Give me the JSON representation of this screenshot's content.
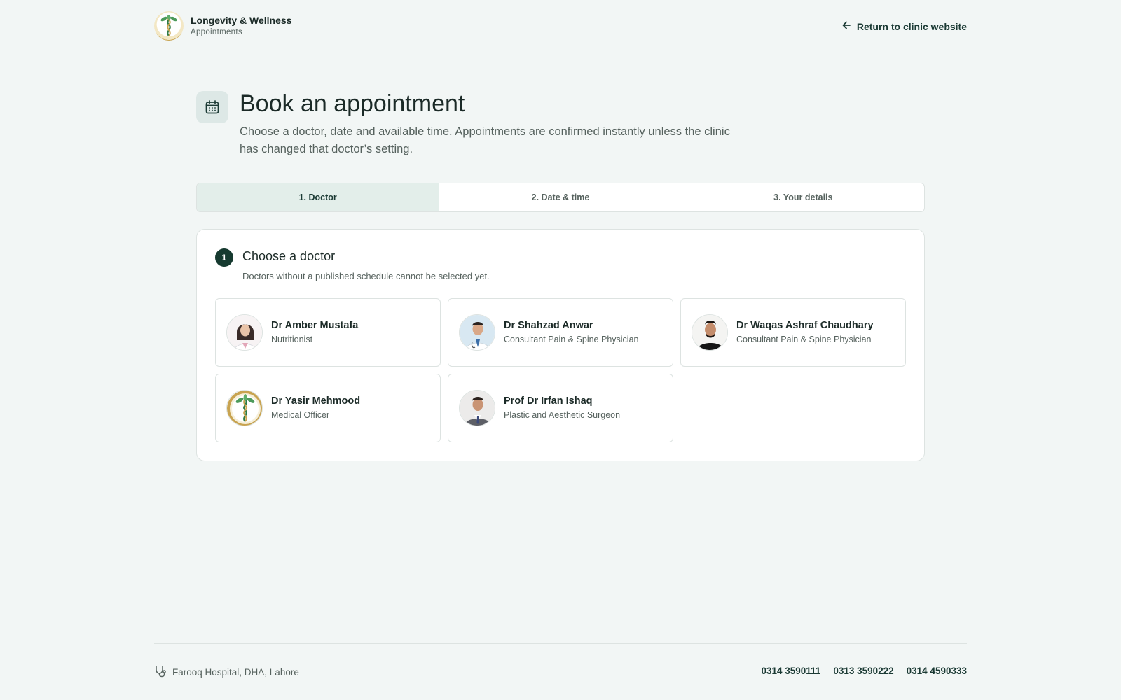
{
  "brand": {
    "name": "Longevity & Wellness",
    "subtitle": "Appointments"
  },
  "header": {
    "return_label": "Return to clinic website",
    "return_icon": "arrow-left-icon"
  },
  "intro": {
    "icon": "calendar-icon",
    "title": "Book an appointment",
    "description": "Choose a doctor, date and available time. Appointments are confirmed instantly unless the clinic has changed that doctor’s setting."
  },
  "steps": [
    {
      "label": "1. Doctor",
      "active": true
    },
    {
      "label": "2. Date & time",
      "active": false
    },
    {
      "label": "3. Your details",
      "active": false
    }
  ],
  "doctor_section": {
    "step_number": "1",
    "title": "Choose a doctor",
    "subtitle": "Doctors without a published schedule cannot be selected yet."
  },
  "doctors": [
    {
      "name": "Dr Amber Mustafa",
      "role": "Nutritionist",
      "avatar": "female-doctor-photo"
    },
    {
      "name": "Dr Shahzad Anwar",
      "role": "Consultant Pain & Spine Physician",
      "avatar": "male-doctor-photo"
    },
    {
      "name": "Dr Waqas Ashraf Chaudhary",
      "role": "Consultant Pain & Spine Physician",
      "avatar": "male-doctor-photo-dark"
    },
    {
      "name": "Dr Yasir Mehmood",
      "role": "Medical Officer",
      "avatar": "clinic-logo"
    },
    {
      "name": "Prof Dr Irfan Ishaq",
      "role": "Plastic and Aesthetic Surgeon",
      "avatar": "male-doctor-photo-suit"
    }
  ],
  "footer": {
    "location_icon": "stethoscope-icon",
    "location": "Farooq Hospital, DHA, Lahore",
    "phones": [
      "0314 3590111",
      "0313 3590222",
      "0314 4590333"
    ]
  },
  "colors": {
    "background": "#f2f6f5",
    "accent_dark": "#163a30",
    "active_step": "#e3eeea",
    "border": "#dde3e1"
  }
}
